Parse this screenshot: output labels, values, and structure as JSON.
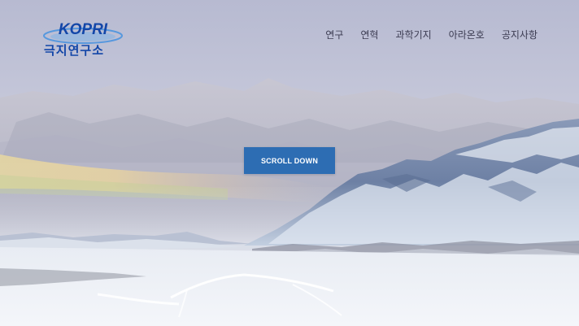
{
  "header": {
    "logo_text": "KOPRI",
    "logo_subtitle": "극지연구소",
    "nav": [
      {
        "label": "연구"
      },
      {
        "label": "연혁"
      },
      {
        "label": "과학기지"
      },
      {
        "label": "아라온호"
      },
      {
        "label": "공지사항"
      }
    ]
  },
  "hero": {
    "button_label": "SCROLL DOWN"
  },
  "colors": {
    "brand": "#1346a8",
    "button": "#2d6db3",
    "nav_text": "#3c3c52"
  },
  "icons": {
    "logo": "kopri-logo-icon"
  }
}
